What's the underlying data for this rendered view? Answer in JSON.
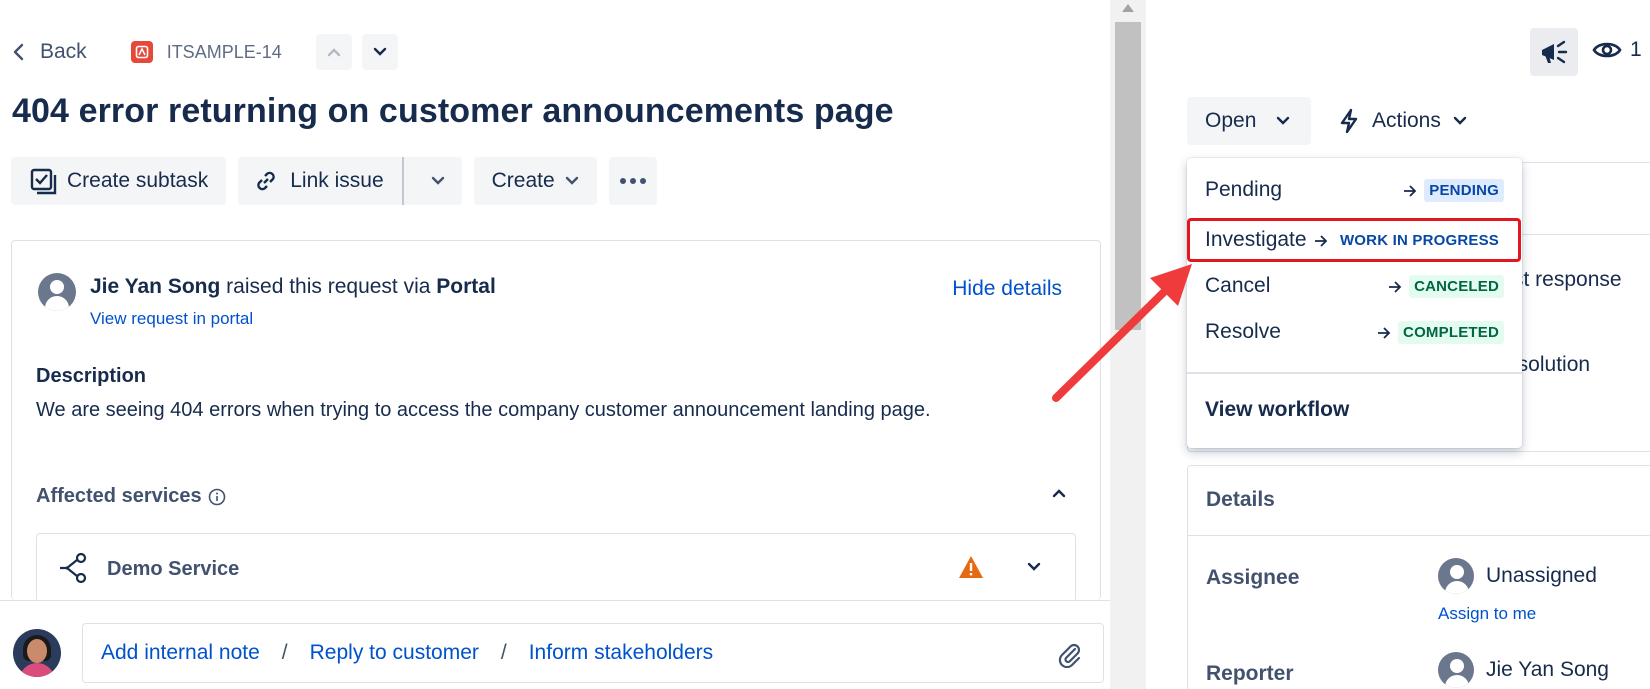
{
  "header": {
    "back_label": "Back",
    "issue_key": "ITSAMPLE-14",
    "title": "404 error returning on customer announcements page"
  },
  "toolbar": {
    "create_subtask": "Create subtask",
    "link_issue": "Link issue",
    "create": "Create"
  },
  "request": {
    "reporter_name": "Jie Yan Song",
    "raised_via_text": "raised this request via",
    "channel": "Portal",
    "view_in_portal": "View request in portal",
    "hide_details": "Hide details",
    "description_label": "Description",
    "description": "We are seeing 404 errors when trying to access the company customer announcement landing page.",
    "affected_services_label": "Affected services",
    "service_name": "Demo Service"
  },
  "comment": {
    "add_internal_note": "Add internal note",
    "reply_to_customer": "Reply to customer",
    "inform_stakeholders": "Inform stakeholders",
    "separator": "/"
  },
  "sidebar": {
    "watch_count": "1",
    "status": "Open",
    "actions": "Actions",
    "sla_first_response": "rst response",
    "sla_resolution": "esolution",
    "details_title": "Details",
    "assignee_label": "Assignee",
    "assignee_value": "Unassigned",
    "assign_to_me": "Assign to me",
    "reporter_label": "Reporter",
    "reporter_value": "Jie Yan Song"
  },
  "transitions": {
    "items": [
      {
        "label": "Pending",
        "target": "PENDING"
      },
      {
        "label": "Investigate",
        "target": "WORK IN PROGRESS"
      },
      {
        "label": "Cancel",
        "target": "CANCELED"
      },
      {
        "label": "Resolve",
        "target": "COMPLETED"
      }
    ],
    "view_workflow": "View workflow"
  },
  "colors": {
    "highlight": "#e3171f",
    "link": "#0052cc",
    "arrow": "#ef3b3b"
  }
}
